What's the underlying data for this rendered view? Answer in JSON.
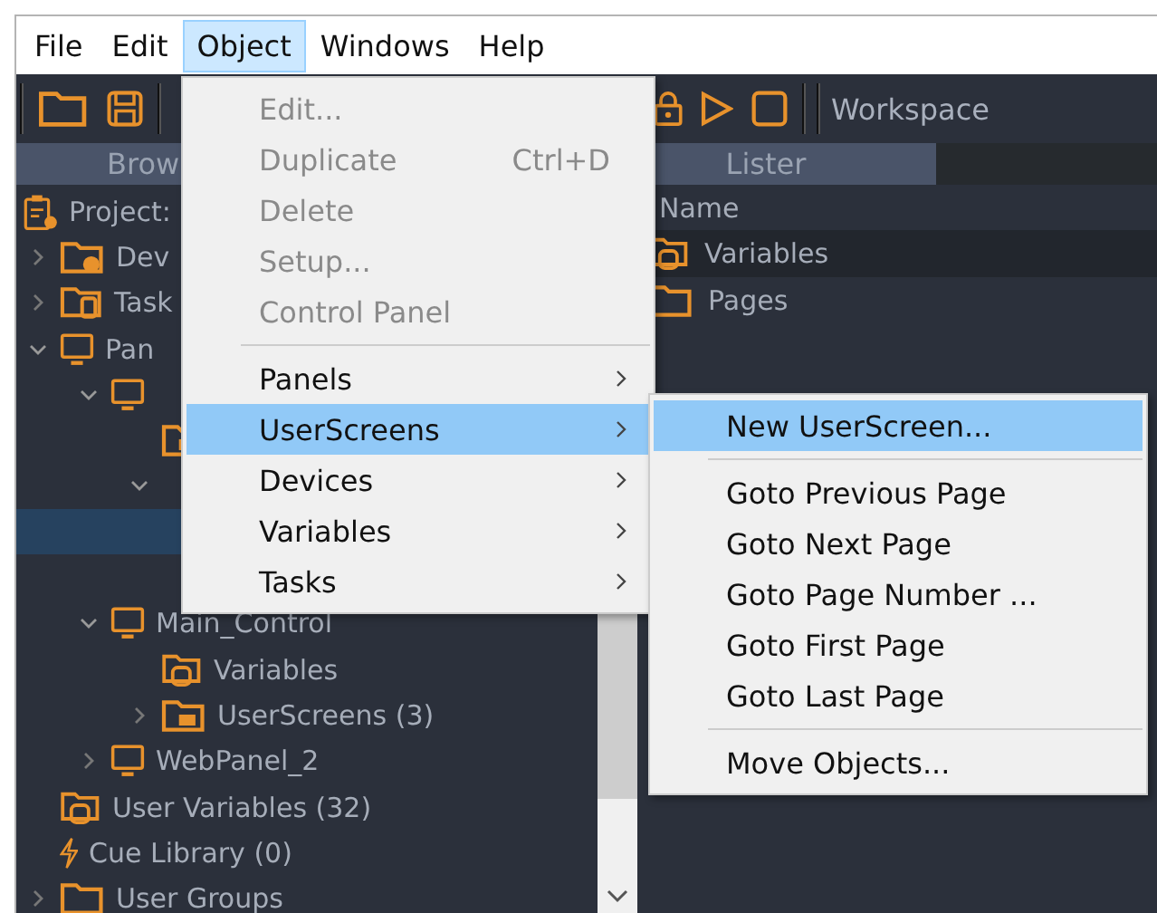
{
  "menubar": [
    {
      "label": "File",
      "selected": false
    },
    {
      "label": "Edit",
      "selected": false
    },
    {
      "label": "Object",
      "selected": true
    },
    {
      "label": "Windows",
      "selected": false
    },
    {
      "label": "Help",
      "selected": false
    }
  ],
  "toolbar": {
    "workspace_label": "Workspace"
  },
  "panel_tabs": [
    {
      "label": "Brow",
      "selected": true
    },
    {
      "label": "Lister",
      "selected": true
    }
  ],
  "tree": [
    {
      "label": "Project:",
      "kind": "project",
      "children": [
        {
          "label": "Dev",
          "kind": "devices",
          "expanded": false,
          "selected": false
        },
        {
          "label": "Task",
          "kind": "tasks",
          "expanded": false,
          "selected": false
        },
        {
          "label": "Pan",
          "kind": "panel",
          "expanded": true,
          "selected": false,
          "children": [
            {
              "kind": "panel",
              "expanded": true,
              "selected": false,
              "children": [
                {
                  "kind": "screens",
                  "selected": false
                },
                {
                  "expanded": true,
                  "selected": false,
                  "children": [
                    {
                      "selected": true
                    },
                    {
                      "selected": false
                    }
                  ]
                }
              ]
            },
            {
              "label": "Main_Control",
              "kind": "panel",
              "expanded": true,
              "selected": false,
              "children": [
                {
                  "label": "Variables",
                  "kind": "variables",
                  "selected": false
                },
                {
                  "label": "UserScreens (3)",
                  "kind": "screens",
                  "expanded": false,
                  "selected": false
                }
              ]
            },
            {
              "label": "WebPanel_2",
              "kind": "panel",
              "expanded": false,
              "selected": false
            }
          ]
        },
        {
          "label": "User Variables (32)",
          "kind": "variables",
          "selected": false
        },
        {
          "label": "Cue Library (0)",
          "kind": "cues",
          "selected": false
        },
        {
          "label": "User Groups",
          "kind": "folder",
          "expanded": false,
          "selected": false
        }
      ]
    }
  ],
  "lister": {
    "column_header": "Name",
    "rows": [
      {
        "label": "Variables",
        "kind": "variables",
        "selected": true
      },
      {
        "label": "Pages",
        "kind": "folder",
        "selected": false
      }
    ]
  },
  "object_menu": [
    {
      "kind": "item",
      "label": "Edit...",
      "disabled": true,
      "selected": false,
      "submenu": false
    },
    {
      "kind": "item",
      "label": "Duplicate",
      "shortcut": "Ctrl+D",
      "disabled": true,
      "selected": false,
      "submenu": false
    },
    {
      "kind": "item",
      "label": "Delete",
      "disabled": true,
      "selected": false,
      "submenu": false
    },
    {
      "kind": "item",
      "label": "Setup...",
      "disabled": true,
      "selected": false,
      "submenu": false
    },
    {
      "kind": "item",
      "label": "Control Panel",
      "disabled": true,
      "selected": false,
      "submenu": false
    },
    {
      "kind": "separator"
    },
    {
      "kind": "item",
      "label": "Panels",
      "disabled": false,
      "selected": false,
      "submenu": true
    },
    {
      "kind": "item",
      "label": "UserScreens",
      "disabled": false,
      "selected": true,
      "submenu": true
    },
    {
      "kind": "item",
      "label": "Devices",
      "disabled": false,
      "selected": false,
      "submenu": true
    },
    {
      "kind": "item",
      "label": "Variables",
      "disabled": false,
      "selected": false,
      "submenu": true
    },
    {
      "kind": "item",
      "label": "Tasks",
      "disabled": false,
      "selected": false,
      "submenu": true
    }
  ],
  "userscreens_submenu": [
    {
      "kind": "item",
      "label": "New UserScreen...",
      "selected": true
    },
    {
      "kind": "separator"
    },
    {
      "kind": "item",
      "label": "Goto Previous Page",
      "selected": false
    },
    {
      "kind": "item",
      "label": "Goto Next Page",
      "selected": false
    },
    {
      "kind": "item",
      "label": "Goto Page Number ...",
      "selected": false
    },
    {
      "kind": "item",
      "label": "Goto First Page",
      "selected": false
    },
    {
      "kind": "item",
      "label": "Goto Last Page",
      "selected": false
    },
    {
      "kind": "separator"
    },
    {
      "kind": "item",
      "label": "Move Objects...",
      "selected": false
    }
  ]
}
